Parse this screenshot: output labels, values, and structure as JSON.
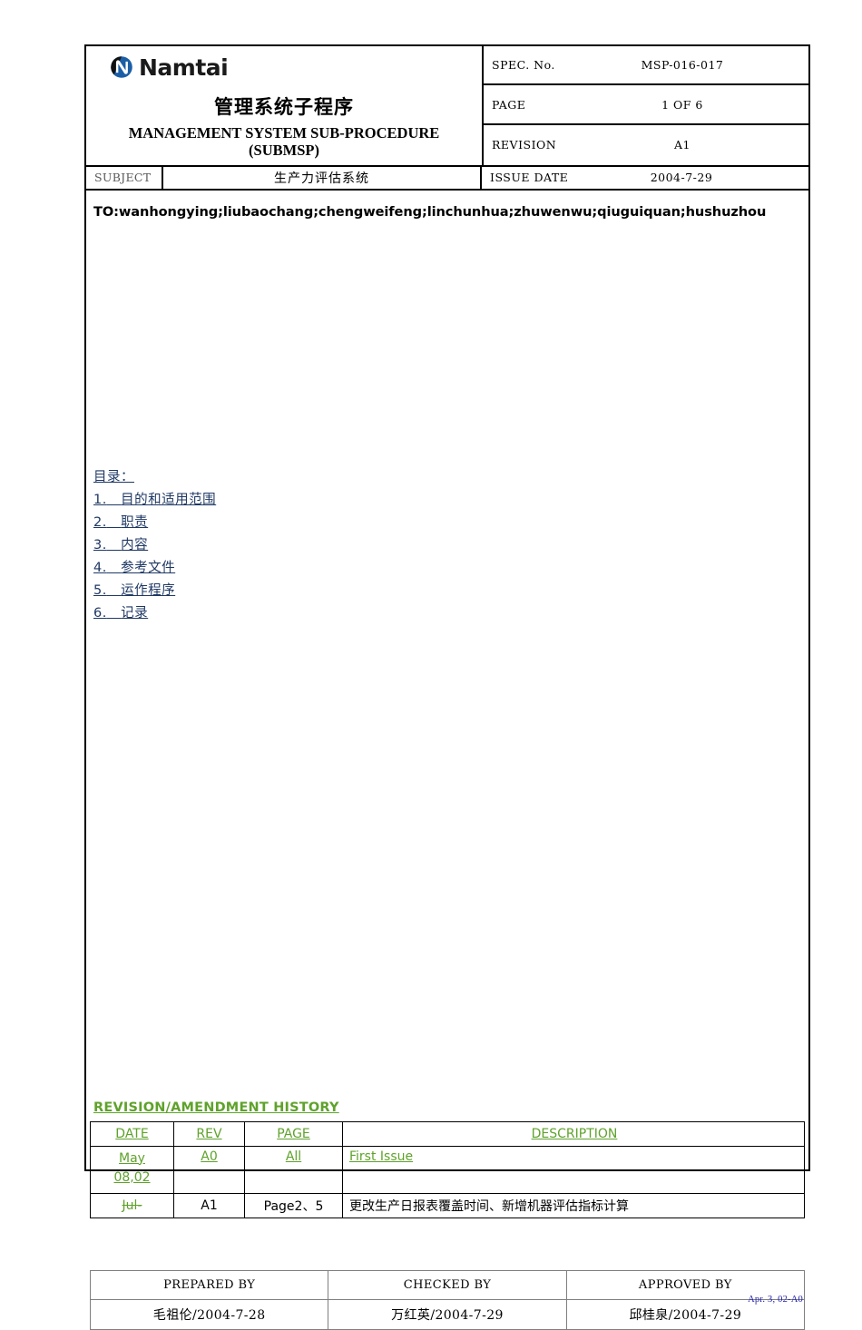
{
  "document": {
    "logo_text": "Namtai",
    "logo_icon": "namtai-circle-n-logo",
    "title_cn": "管理系统子程序",
    "title_en_line1": "MANAGEMENT SYSTEM SUB-PROCEDURE",
    "title_en_line2": "(SUBMSP)"
  },
  "spec": {
    "spec_no_label": "SPEC. No.",
    "spec_no_value": "MSP-016-017",
    "page_label": "PAGE",
    "page_value": "1 OF 6",
    "revision_label": "REVISION",
    "revision_value": "A1",
    "issue_date_label": "ISSUE DATE",
    "issue_date_value": "2004-7-29",
    "subject_label": "SUBJECT",
    "subject_value": "生产力评估系统"
  },
  "body": {
    "to_line": "TO:wanhongying;liubaochang;chengweifeng;linchunhua;zhuwenwu;qiuguiquan;hushuzhou",
    "toc_title": "目录：",
    "toc_items": [
      {
        "num": "1.",
        "label": "目的和适用范围"
      },
      {
        "num": "2.",
        "label": "职责"
      },
      {
        "num": "3.",
        "label": "内容"
      },
      {
        "num": "4.",
        "label": "参考文件"
      },
      {
        "num": "5.",
        "label": "运作程序"
      },
      {
        "num": "6.",
        "label": "记录"
      }
    ]
  },
  "revision_history": {
    "heading": "REVISION/AMENDMENT HISTORY",
    "columns": [
      "DATE",
      "REV",
      "PAGE",
      "DESCRIPTION"
    ],
    "rows": [
      {
        "date_line1": "May",
        "date_line2": "08,02",
        "rev": "A0",
        "page": "All",
        "description": "First Issue"
      },
      {
        "date_line1": "Jul-",
        "date_line2": "",
        "rev": "A1",
        "page": "Page2、5",
        "description": "更改生产日报表覆盖时间、新增机器评估指标计算"
      }
    ]
  },
  "signatures": {
    "headers": [
      "PREPARED BY",
      "CHECKED BY",
      "APPROVED BY"
    ],
    "values": [
      "毛祖伦/2004-7-28",
      "万红英/2004-7-29",
      "邱桂泉/2004-7-29"
    ]
  },
  "footer": {
    "form_code": "Apr. 3, 02-A0"
  },
  "colors": {
    "green": "#5FA22B",
    "link_blue": "#1F3864",
    "footer_blue": "#2222AA",
    "logo_blue": "#1B5EA6"
  }
}
